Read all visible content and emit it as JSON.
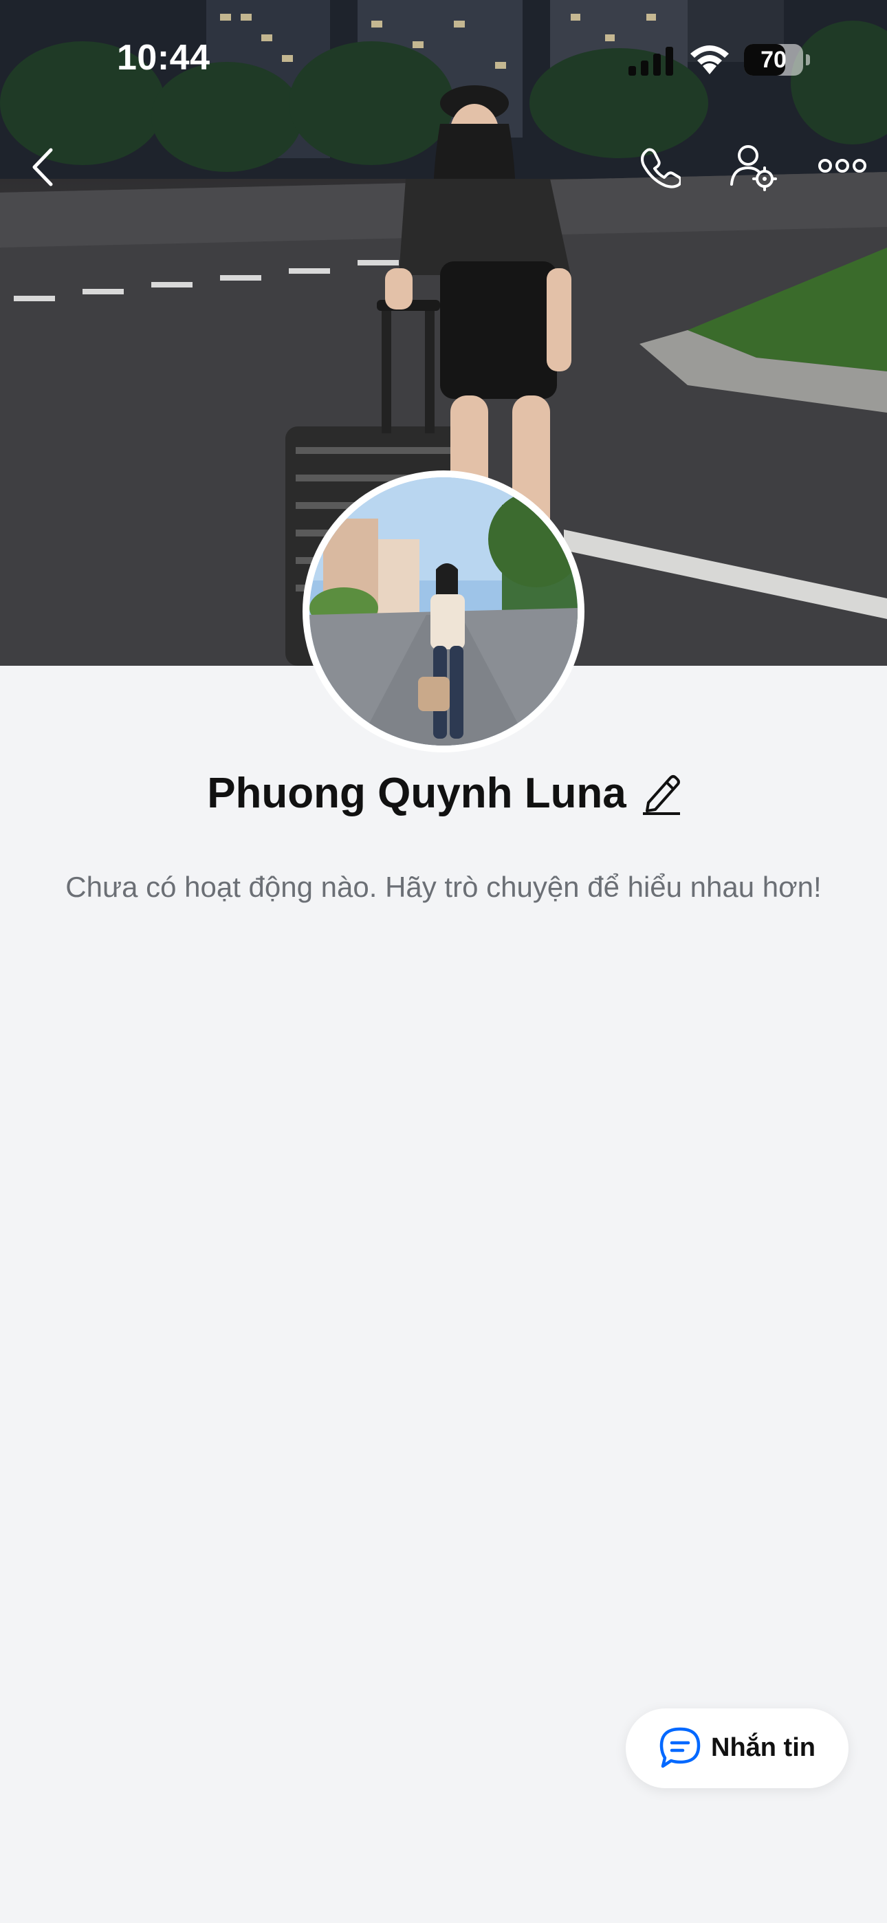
{
  "status_bar": {
    "time": "10:44",
    "battery_level": "70",
    "icons": [
      "signal-icon",
      "wifi-icon",
      "battery-icon"
    ]
  },
  "nav": {
    "back_icon": "chevron-left-icon",
    "call_icon": "phone-icon",
    "settings_icon": "user-settings-icon",
    "more_icon": "more-dots-icon"
  },
  "profile": {
    "name": "Phuong Quynh Luna",
    "edit_icon": "pencil-icon",
    "empty_message": "Chưa có hoạt động nào. Hãy trò chuyện để hiểu nhau hơn!"
  },
  "message_button": {
    "label": "Nhắn tin",
    "icon": "chat-bubble-icon"
  },
  "colors": {
    "background": "#f3f4f6",
    "accent": "#0068ff",
    "text_primary": "#111111",
    "text_secondary": "#6b6f75"
  }
}
